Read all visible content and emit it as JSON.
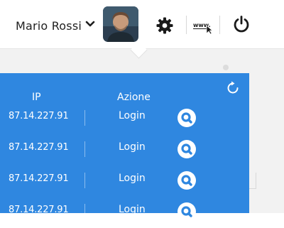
{
  "header": {
    "user_name": "Mario Rossi",
    "icons": [
      "chevron-down-icon",
      "gear-icon",
      "www-cursor-icon",
      "power-icon"
    ],
    "www_label": "www."
  },
  "panel": {
    "columns": {
      "ip": "IP",
      "action": "Azione"
    },
    "rows": [
      {
        "ip": "87.14.227.91",
        "action": "Login"
      },
      {
        "ip": "87.14.227.91",
        "action": "Login"
      },
      {
        "ip": "87.14.227.91",
        "action": "Login"
      },
      {
        "ip": "87.14.227.91",
        "action": "Login"
      }
    ]
  },
  "colors": {
    "panel": "#2f87e0",
    "icon_dark": "#1a1a1a"
  }
}
